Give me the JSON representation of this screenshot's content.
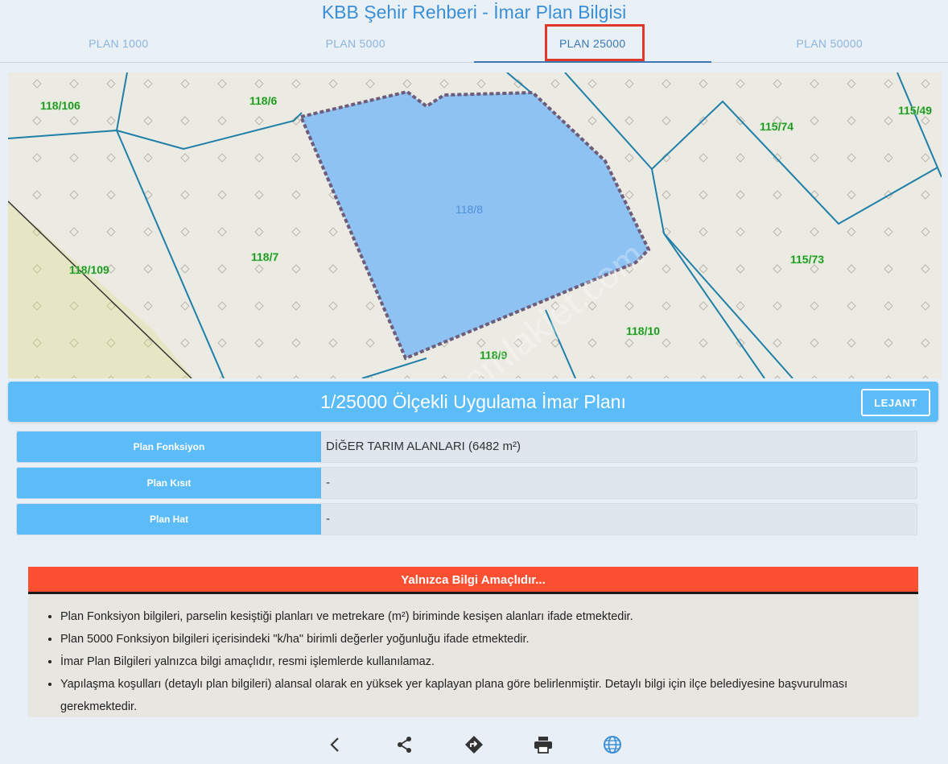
{
  "app": {
    "title": "KBB Şehir Rehberi - İmar Plan Bilgisi"
  },
  "tabs": [
    {
      "label": "PLAN 1000",
      "active": false
    },
    {
      "label": "PLAN 5000",
      "active": false
    },
    {
      "label": "PLAN 25000",
      "active": true
    },
    {
      "label": "PLAN 50000",
      "active": false
    }
  ],
  "map": {
    "parcel_labels": [
      "118/106",
      "118/6",
      "118/8",
      "118/7",
      "118/109",
      "118/9",
      "118/10",
      "115/74",
      "115/49",
      "115/73"
    ],
    "selected_parcel_color": "#8ec2f3",
    "road_color": "#1f7fa8",
    "watermark": "emlakjet.com"
  },
  "plan_header": {
    "title": "1/25000 Ölçekli Uygulama İmar Planı",
    "legend_label": "LEJANT"
  },
  "info_rows": [
    {
      "label": "Plan Fonksiyon",
      "value": "DİĞER TARIM ALANLARI (6482 m²)"
    },
    {
      "label": "Plan Kısıt",
      "value": "-"
    },
    {
      "label": "Plan Hat",
      "value": "-"
    }
  ],
  "notice": {
    "title": "Yalnızca Bilgi Amaçlıdır...",
    "items": [
      "Plan Fonksiyon bilgileri, parselin kesiştiği planları ve metrekare (m²) biriminde kesişen alanları ifade etmektedir.",
      "Plan 5000 Fonksiyon bilgileri içerisindeki \"k/ha\" birimli değerler yoğunluğu ifade etmektedir.",
      "İmar Plan Bilgileri yalnızca bilgi amaçlıdır, resmi işlemlerde kullanılamaz.",
      "Yapılaşma koşulları (detaylı plan bilgileri) alansal olarak en yüksek yer kaplayan plana göre belirlenmiştir. Detaylı bilgi için ilçe belediyesine başvurulması gerekmektedir."
    ]
  },
  "bottom_bar": {
    "icons": [
      "back-icon",
      "share-icon",
      "directions-icon",
      "print-icon",
      "globe-icon"
    ]
  },
  "colors": {
    "accent": "#5bbcf8",
    "warning": "#fa4f30",
    "tab_highlight": "#e0392b"
  }
}
